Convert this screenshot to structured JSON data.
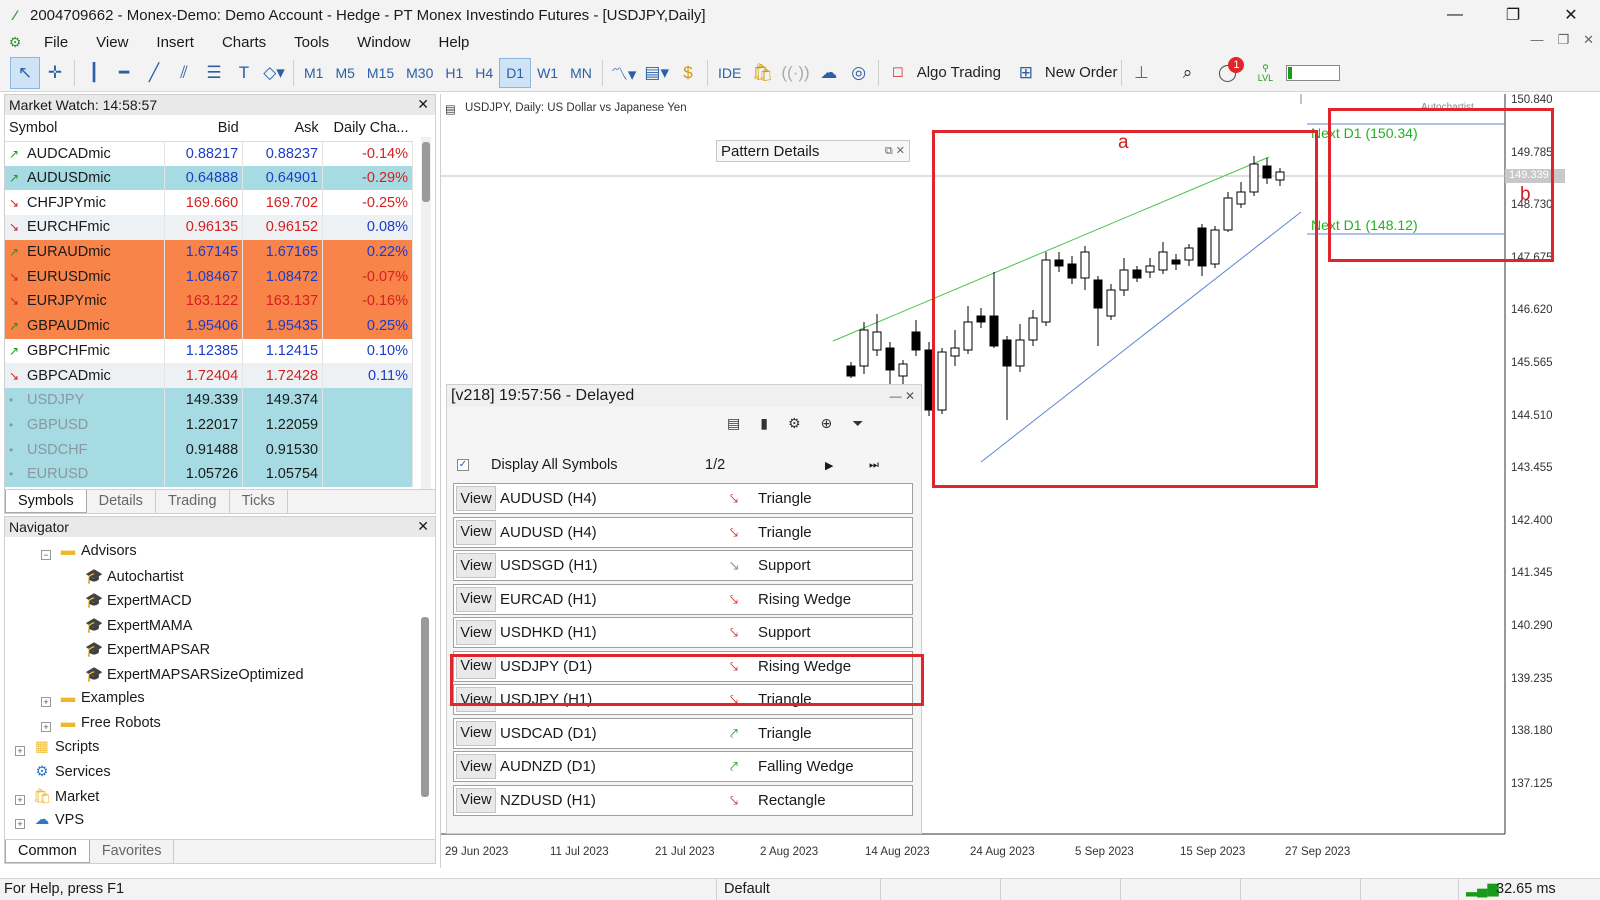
{
  "window": {
    "title": "2004709662 - Monex-Demo: Demo Account - Hedge - PT Monex Investindo Futures - [USDJPY,Daily]",
    "min_icon": "minimize-icon",
    "max_icon": "restore-icon",
    "close_icon": "close-icon"
  },
  "menu": [
    "File",
    "View",
    "Insert",
    "Charts",
    "Tools",
    "Window",
    "Help"
  ],
  "toolbar": {
    "timeframes": [
      "M1",
      "M5",
      "M15",
      "M30",
      "H1",
      "H4",
      "D1",
      "W1",
      "MN"
    ],
    "active_timeframe": "D1",
    "ide_label": "IDE",
    "algo_trading_label": "Algo Trading",
    "new_order_label": "New Order",
    "notification_count": "1",
    "lvl_label": "LVL"
  },
  "market_watch": {
    "title": "Market Watch: 14:58:57",
    "columns": [
      "Symbol",
      "Bid",
      "Ask",
      "Daily Cha..."
    ],
    "rows": [
      {
        "symbol": "AUDCADmic",
        "bid": "0.88217",
        "ask": "0.88237",
        "change": "-0.14%",
        "dir": "up",
        "style": "white",
        "bidc": "blue",
        "chc": "red"
      },
      {
        "symbol": "AUDUSDmic",
        "bid": "0.64888",
        "ask": "0.64901",
        "change": "-0.29%",
        "dir": "up",
        "style": "teal",
        "bidc": "blue",
        "chc": "red"
      },
      {
        "symbol": "CHFJPYmic",
        "bid": "169.660",
        "ask": "169.702",
        "change": "-0.25%",
        "dir": "down",
        "style": "white",
        "bidc": "red",
        "chc": "red"
      },
      {
        "symbol": "EURCHFmic",
        "bid": "0.96135",
        "ask": "0.96152",
        "change": "0.08%",
        "dir": "down",
        "style": "light",
        "bidc": "red",
        "chc": "blue"
      },
      {
        "symbol": "EURAUDmic",
        "bid": "1.67145",
        "ask": "1.67165",
        "change": "0.22%",
        "dir": "up",
        "style": "orange",
        "bidc": "blue",
        "chc": "blue"
      },
      {
        "symbol": "EURUSDmic",
        "bid": "1.08467",
        "ask": "1.08472",
        "change": "-0.07%",
        "dir": "down",
        "style": "orange",
        "bidc": "blue",
        "chc": "red"
      },
      {
        "symbol": "EURJPYmic",
        "bid": "163.122",
        "ask": "163.137",
        "change": "-0.16%",
        "dir": "down",
        "style": "orange",
        "bidc": "red",
        "chc": "red"
      },
      {
        "symbol": "GBPAUDmic",
        "bid": "1.95406",
        "ask": "1.95435",
        "change": "0.25%",
        "dir": "up",
        "style": "orange",
        "bidc": "blue",
        "chc": "blue"
      },
      {
        "symbol": "GBPCHFmic",
        "bid": "1.12385",
        "ask": "1.12415",
        "change": "0.10%",
        "dir": "up",
        "style": "white",
        "bidc": "blue",
        "chc": "blue"
      },
      {
        "symbol": "GBPCADmic",
        "bid": "1.72404",
        "ask": "1.72428",
        "change": "0.11%",
        "dir": "down",
        "style": "light",
        "bidc": "red",
        "chc": "blue"
      },
      {
        "symbol": "USDJPY",
        "bid": "149.339",
        "ask": "149.374",
        "change": "",
        "dir": "dot",
        "style": "teal",
        "bidc": "black",
        "chc": "black"
      },
      {
        "symbol": "GBPUSD",
        "bid": "1.22017",
        "ask": "1.22059",
        "change": "",
        "dir": "dot",
        "style": "teal",
        "bidc": "black",
        "chc": "black"
      },
      {
        "symbol": "USDCHF",
        "bid": "0.91488",
        "ask": "0.91530",
        "change": "",
        "dir": "dot",
        "style": "teal",
        "bidc": "black",
        "chc": "black"
      },
      {
        "symbol": "EURUSD",
        "bid": "1.05726",
        "ask": "1.05754",
        "change": "",
        "dir": "dot",
        "style": "teal",
        "bidc": "black",
        "chc": "black"
      }
    ],
    "tabs": [
      "Symbols",
      "Details",
      "Trading",
      "Ticks"
    ]
  },
  "navigator": {
    "title": "Navigator",
    "items": {
      "advisors": "Advisors",
      "autochartist": "Autochartist",
      "expertmacd": "ExpertMACD",
      "expertmama": "ExpertMAMA",
      "expertmapsar": "ExpertMAPSAR",
      "expertmapsarsize": "ExpertMAPSARSizeOptimized",
      "examples": "Examples",
      "freerobots": "Free Robots",
      "scripts": "Scripts",
      "services": "Services",
      "market": "Market",
      "vps": "VPS"
    },
    "tabs": [
      "Common",
      "Favorites"
    ]
  },
  "chart": {
    "header": "USDJPY, Daily:  US Dollar vs Japanese Yen",
    "autochartist_label": "Autochartist",
    "pattern_details": "Pattern Details",
    "current_price": "149.339",
    "price_labels": [
      "150.840",
      "149.785",
      "148.730",
      "147.675",
      "146.620",
      "145.565",
      "144.510",
      "143.455",
      "142.400",
      "141.345",
      "140.290",
      "139.235",
      "138.180",
      "137.125"
    ],
    "date_labels": [
      "29 Jun 2023",
      "11 Jul 2023",
      "21 Jul 2023",
      "2 Aug 2023",
      "14 Aug 2023",
      "24 Aug 2023",
      "5 Sep 2023",
      "15 Sep 2023",
      "27 Sep 2023"
    ],
    "next_high": "Next D1 (150.34)",
    "next_low": "Next D1 (148.12)",
    "annotation_a": "a",
    "annotation_b": "b"
  },
  "autochartist_panel": {
    "title": "[v218] 19:57:56 - Delayed",
    "display_all": "Display All Symbols",
    "page": "1/2",
    "view_label": "View",
    "rows": [
      {
        "symbol": "AUDUSD (H4)",
        "pattern": "Triangle",
        "trend": "down"
      },
      {
        "symbol": "AUDUSD (H4)",
        "pattern": "Triangle",
        "trend": "down"
      },
      {
        "symbol": "USDSGD (H1)",
        "pattern": "Support",
        "trend": "neutral"
      },
      {
        "symbol": "EURCAD (H1)",
        "pattern": "Rising Wedge",
        "trend": "down"
      },
      {
        "symbol": "USDHKD (H1)",
        "pattern": "Support",
        "trend": "down"
      },
      {
        "symbol": "USDJPY (D1)",
        "pattern": "Rising Wedge",
        "trend": "down"
      },
      {
        "symbol": "USDJPY (H1)",
        "pattern": "Triangle",
        "trend": "down"
      },
      {
        "symbol": "USDCAD (D1)",
        "pattern": "Triangle",
        "trend": "up"
      },
      {
        "symbol": "AUDNZD (D1)",
        "pattern": "Falling Wedge",
        "trend": "up"
      },
      {
        "symbol": "NZDUSD (H1)",
        "pattern": "Rectangle",
        "trend": "down"
      }
    ]
  },
  "statusbar": {
    "help": "For Help, press F1",
    "profile": "Default",
    "ping": "32.65 ms"
  },
  "colors": {
    "accent": "#2b5fa8",
    "annotation_red": "#e0262a",
    "bull_green": "#1a9a1a",
    "bear_red": "#d42020",
    "teal_row": "#a7dbe3",
    "orange_row": "#f9844a"
  }
}
